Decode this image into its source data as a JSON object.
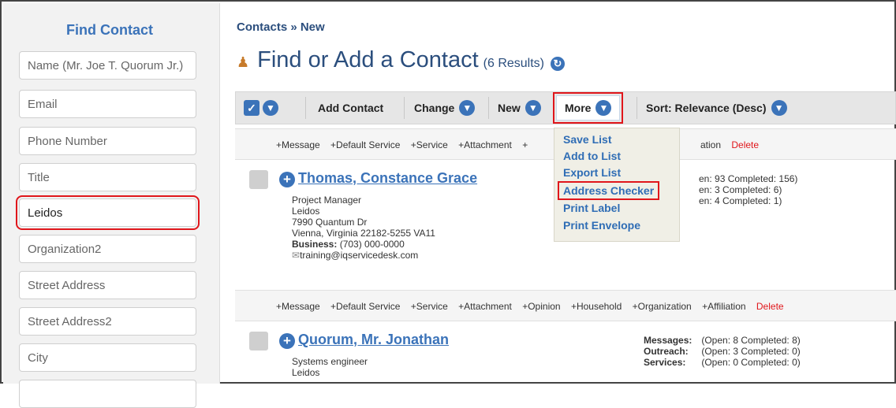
{
  "sidebar": {
    "title": "Find Contact",
    "fields": [
      {
        "placeholder": "Name (Mr. Joe T. Quorum Jr.)",
        "value": ""
      },
      {
        "placeholder": "Email",
        "value": ""
      },
      {
        "placeholder": "Phone Number",
        "value": ""
      },
      {
        "placeholder": "Title",
        "value": ""
      },
      {
        "placeholder": "",
        "value": "Leidos"
      },
      {
        "placeholder": "Organization2",
        "value": ""
      },
      {
        "placeholder": "Street Address",
        "value": ""
      },
      {
        "placeholder": "Street Address2",
        "value": ""
      },
      {
        "placeholder": "City",
        "value": ""
      }
    ]
  },
  "main": {
    "breadcrumb": "Contacts » New",
    "title": "Find or Add a Contact",
    "result_count": "(6 Results)",
    "toolbar": {
      "add_contact": "Add Contact",
      "change": "Change",
      "new": "New",
      "more": "More",
      "sort": "Sort: Relevance (Desc)"
    },
    "actions": {
      "row1_left": [
        "+Message",
        "+Default Service",
        "+Service",
        "+Attachment",
        "+"
      ],
      "row1_right": [
        "ation",
        "Delete"
      ],
      "row2": [
        "+Message",
        "+Default Service",
        "+Service",
        "+Attachment",
        "+Opinion",
        "+Household",
        "+Organization",
        "+Affiliation"
      ],
      "delete": "Delete"
    },
    "more_menu": [
      "Save List",
      "Add to List",
      "Export List",
      "Address Checker",
      "Print Label",
      "Print Envelope"
    ],
    "contacts": [
      {
        "name": "Thomas, Constance Grace",
        "title": "Project Manager",
        "org": "Leidos",
        "street": "7990 Quantum Dr",
        "city": "Vienna, Virginia 22182-5255 VA11",
        "business_label": "Business:",
        "business": "(703) 000-0000",
        "email": "training@iqservicedesk.com",
        "stats_partial": [
          "en: 93 Completed: 156)",
          "en: 3 Completed: 6)",
          "en: 4 Completed: 1)"
        ]
      },
      {
        "name": "Quorum, Mr. Jonathan",
        "title": "Systems engineer",
        "org": "Leidos",
        "stats": [
          {
            "label": "Messages:",
            "value": "(Open: 8 Completed: 8)"
          },
          {
            "label": "Outreach:",
            "value": "(Open: 3 Completed: 0)"
          },
          {
            "label": "Services:",
            "value": "(Open: 0 Completed: 0)"
          }
        ]
      }
    ]
  },
  "colors": {
    "accent": "#3b73b9",
    "highlight": "#e0161b",
    "heading": "#2b4e7d"
  }
}
